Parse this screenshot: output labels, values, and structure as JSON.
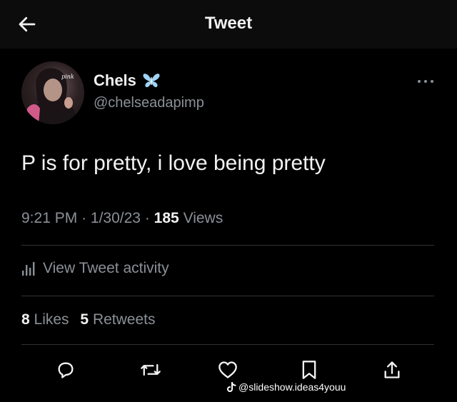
{
  "header": {
    "title": "Tweet",
    "back_icon": "arrow-left-icon"
  },
  "author": {
    "display_name": "Chels",
    "badge_icon": "butterfly-icon",
    "badge_color": "#9fd4f5",
    "handle": "@chelseadapimp",
    "more_icon": "more-horizontal-icon"
  },
  "tweet": {
    "text": "P is for pretty, i love being pretty",
    "time": "9:21 PM",
    "separator": "·",
    "date": "1/30/23",
    "views_count": "185",
    "views_label": "Views"
  },
  "activity": {
    "label": "View Tweet activity",
    "icon": "analytics-icon"
  },
  "stats": {
    "likes_count": "8",
    "likes_label": "Likes",
    "retweets_count": "5",
    "retweets_label": "Retweets"
  },
  "actions": {
    "reply_icon": "reply-icon",
    "retweet_icon": "retweet-icon",
    "like_icon": "heart-icon",
    "bookmark_icon": "bookmark-icon",
    "share_icon": "share-icon"
  },
  "watermark": {
    "icon": "tiktok-icon",
    "text": "@slideshow.ideas4youu"
  },
  "colors": {
    "background": "#000000",
    "header_background": "#0c0c0c",
    "text_primary": "#f2f2f2",
    "text_secondary": "#8b9096",
    "divider": "#2f3336"
  }
}
